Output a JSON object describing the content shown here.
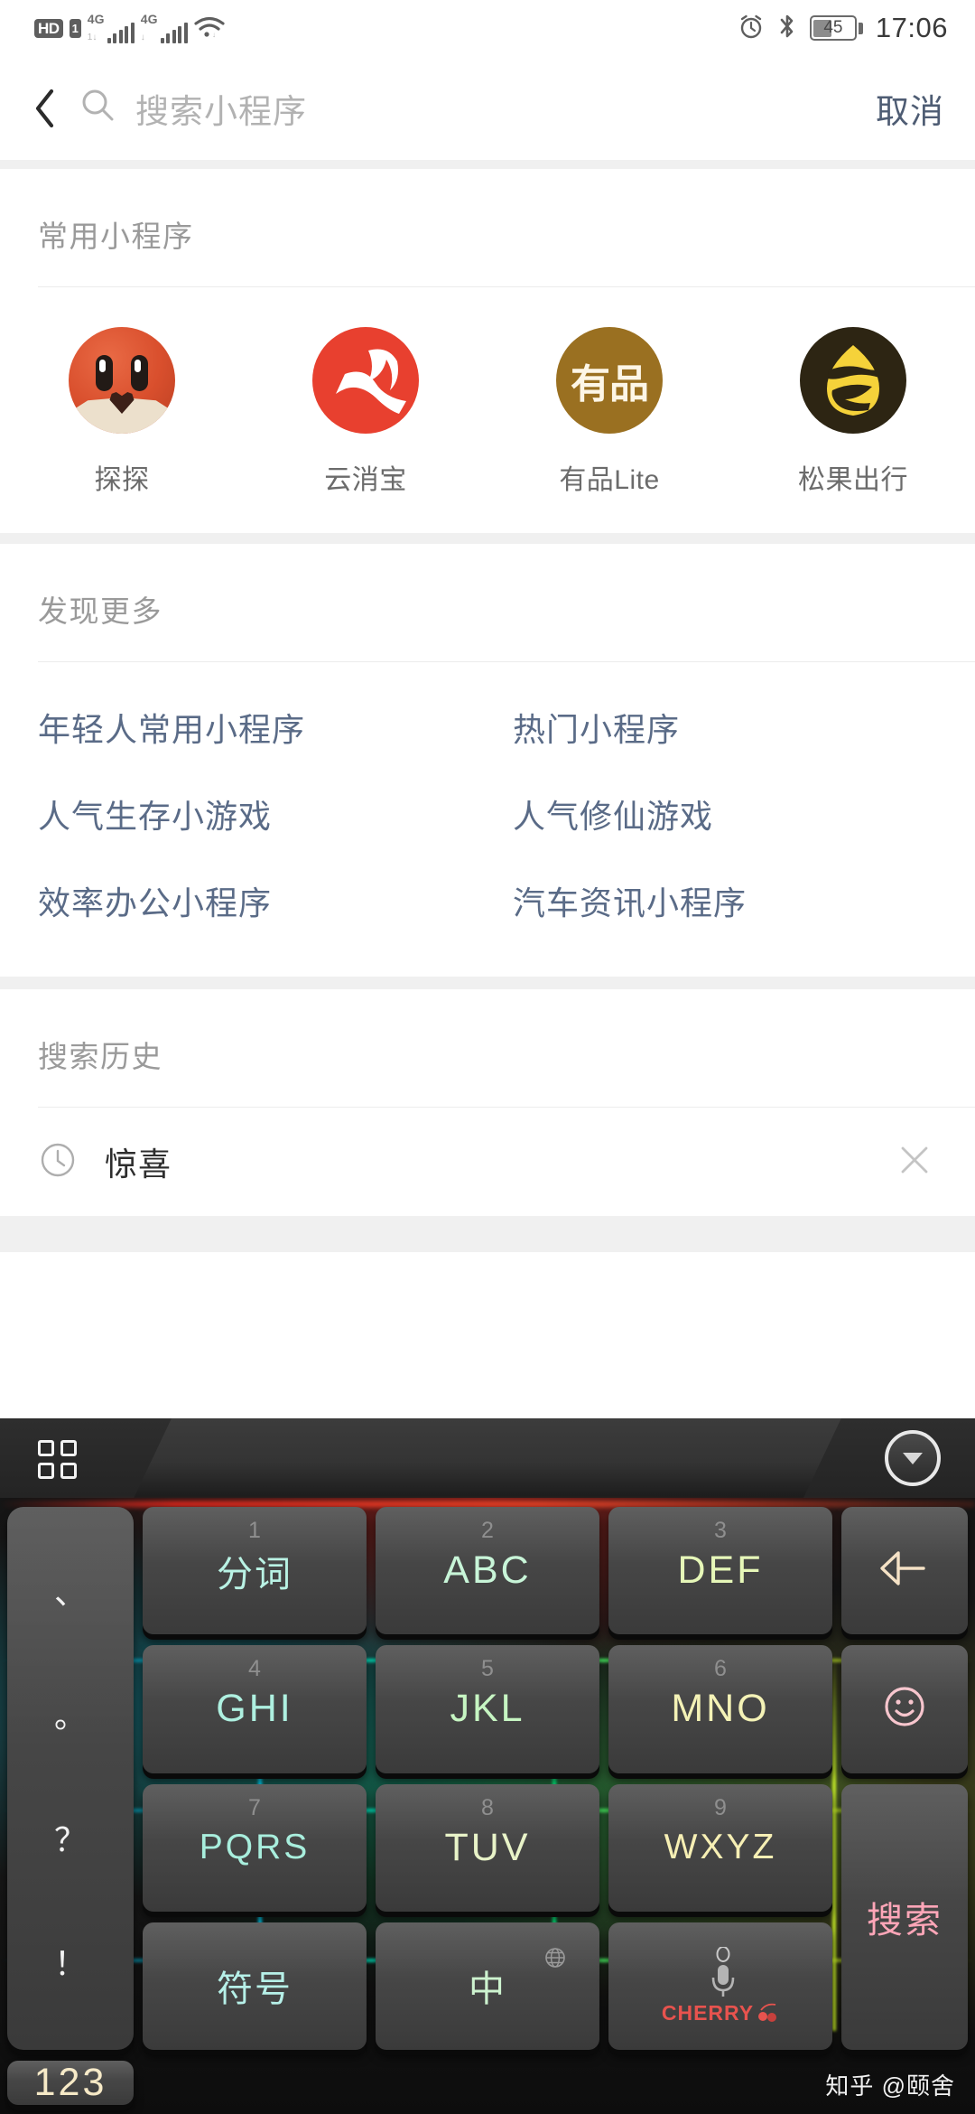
{
  "status_bar": {
    "hd_label": "HD",
    "sim_label": "1",
    "net1_label": "4G",
    "net1_sub": "1↓",
    "net2_label": "4G",
    "net2_sub": "↓",
    "wifi_icon": "wifi-icon",
    "alarm_icon": "alarm-icon",
    "bluetooth_icon": "bluetooth-icon",
    "battery_level": "45",
    "battery_percent": 45,
    "time": "17:06"
  },
  "search": {
    "back_icon": "back-chevron-icon",
    "search_icon": "search-icon",
    "placeholder": "搜索小程序",
    "value": "",
    "cancel_label": "取消"
  },
  "frequent": {
    "title": "常用小程序",
    "apps": [
      {
        "label": "探探",
        "icon": "tantan-app-icon",
        "color": "#d94f2d"
      },
      {
        "label": "云消宝",
        "icon": "yunxiaobao-app-icon",
        "color": "#e8402f"
      },
      {
        "label": "有品Lite",
        "icon": "youpin-app-icon",
        "color": "#9a7021",
        "glyph": "有品"
      },
      {
        "label": "松果出行",
        "icon": "songguo-app-icon",
        "color": "#2d2513"
      }
    ]
  },
  "discover": {
    "title": "发现更多",
    "links": [
      "年轻人常用小程序",
      "热门小程序",
      "人气生存小游戏",
      "人气修仙游戏",
      "效率办公小程序",
      "汽车资讯小程序"
    ],
    "link_color": "#5a6b87"
  },
  "history": {
    "title": "搜索历史",
    "items": [
      {
        "text": "惊喜",
        "clock_icon": "clock-icon",
        "delete_icon": "close-icon"
      }
    ]
  },
  "keyboard": {
    "toolbar": {
      "grid_icon": "keyboard-grid-icon",
      "hide_icon": "chevron-down-icon"
    },
    "punct_key": {
      "name": "punctuation-key",
      "chars": [
        "、",
        "。",
        "？",
        "！"
      ]
    },
    "keys": [
      {
        "num": "1",
        "main": "分词",
        "type": "cn",
        "color": "#b9f2e4"
      },
      {
        "num": "2",
        "main": "ABC",
        "type": "lat",
        "color": "#c8f5d8"
      },
      {
        "num": "3",
        "main": "DEF",
        "type": "lat",
        "color": "#e6f7b8"
      },
      {
        "num": "4",
        "main": "GHI",
        "type": "lat",
        "color": "#aef0e0"
      },
      {
        "num": "5",
        "main": "JKL",
        "type": "lat",
        "color": "#c6f5c2"
      },
      {
        "num": "6",
        "main": "MNO",
        "type": "lat",
        "color": "#f4f2b6"
      },
      {
        "num": "7",
        "main": "PQRS",
        "type": "lat",
        "color": "#a8eedd"
      },
      {
        "num": "8",
        "main": "TUV",
        "type": "lat",
        "color": "#e8f3c8"
      },
      {
        "num": "9",
        "main": "WXYZ",
        "type": "lat",
        "color": "#f6efb4"
      }
    ],
    "backspace": {
      "name": "backspace-key",
      "icon": "backspace-icon",
      "color": "#f5e2c6"
    },
    "emoji": {
      "name": "emoji-key",
      "icon": "smiley-icon",
      "color": "#f7c5cd"
    },
    "symbol_key": {
      "label": "符号",
      "color": "#b6f0e8"
    },
    "lang_key": {
      "label": "中",
      "globe_icon": "globe-icon",
      "color": "#cdf3cf"
    },
    "mic_key": {
      "icon": "microphone-icon",
      "brand": "CHERRY"
    },
    "num_key": {
      "label": "123",
      "color": "#f6e9c6"
    },
    "search_key": {
      "label": "搜索",
      "color": "#ffa6b8"
    }
  },
  "watermark": "知乎 @颐舍"
}
